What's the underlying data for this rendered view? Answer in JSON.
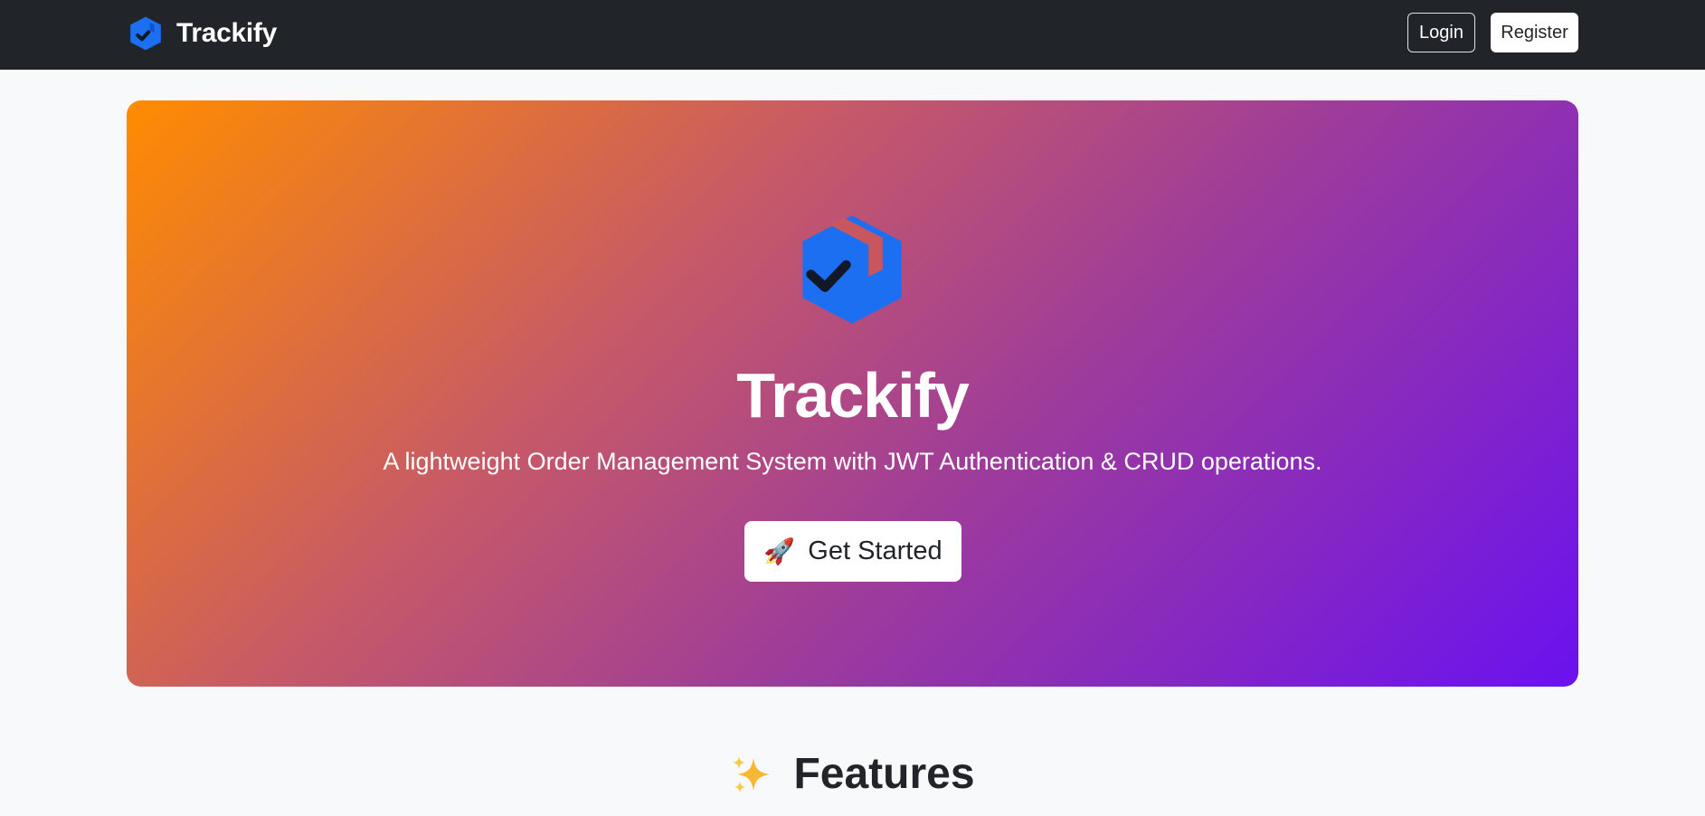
{
  "navbar": {
    "brand": "Trackify",
    "login_label": "Login",
    "register_label": "Register"
  },
  "hero": {
    "title": "Trackify",
    "subtitle": "A lightweight Order Management System with JWT Authentication & CRUD operations.",
    "cta_icon": "🚀",
    "cta_label": "Get Started"
  },
  "features": {
    "heading": "Features"
  },
  "icons": {
    "brand": "box-check-icon",
    "hero": "box-check-icon",
    "cta": "rocket-icon",
    "features": "sparkles-icon"
  },
  "colors": {
    "navbar_bg": "#212529",
    "logo_blue": "#1d6ff2",
    "gradient_start": "#ff8c00",
    "gradient_end": "#6a11f0",
    "page_bg": "#f8f9fa"
  }
}
